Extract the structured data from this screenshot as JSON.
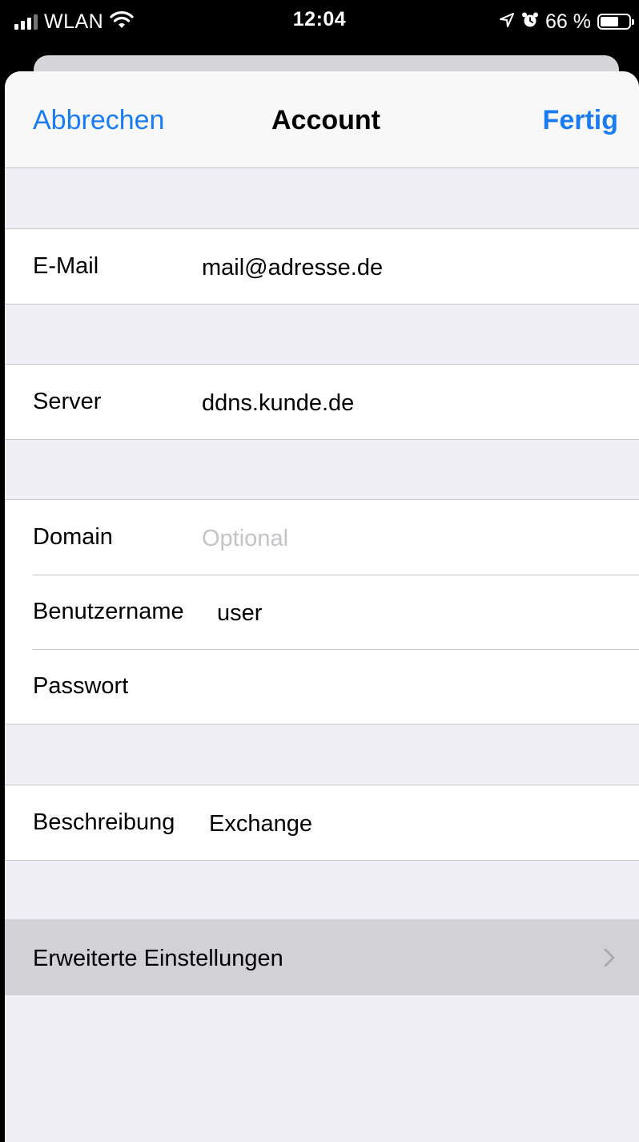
{
  "status_bar": {
    "carrier": "WLAN",
    "time": "12:04",
    "battery_percent": "66 %",
    "battery_level": 0.66
  },
  "nav": {
    "cancel_label": "Abbrechen",
    "title": "Account",
    "done_label": "Fertig"
  },
  "fields": {
    "email": {
      "label": "E-Mail",
      "value": "mail@adresse.de"
    },
    "server": {
      "label": "Server",
      "value": "ddns.kunde.de"
    },
    "domain": {
      "label": "Domain",
      "value": "",
      "placeholder": "Optional"
    },
    "username": {
      "label": "Benutzername",
      "value": "user"
    },
    "password": {
      "label": "Passwort",
      "value": ""
    },
    "description": {
      "label": "Beschreibung",
      "value": "Exchange"
    }
  },
  "advanced": {
    "label": "Erweiterte Einstellungen"
  },
  "colors": {
    "accent": "#1a7cf2",
    "grouped_background": "#f0eff5",
    "highlight_row": "#d1d1d6"
  }
}
